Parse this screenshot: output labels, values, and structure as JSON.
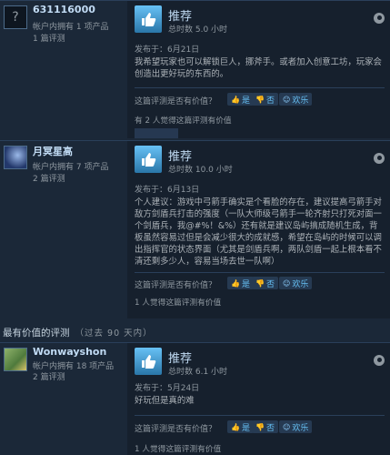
{
  "reviews": [
    {
      "avatar_glyph": "?",
      "name": "631116000",
      "products": "帐户内拥有 1 项产品",
      "review_count": "1 篇评测",
      "verdict": "推荐",
      "hours": "总时数 5.0 小时",
      "posted": "发布于：6月21日",
      "body": "我希望玩家也可以解锁巨人，挪斧手。或者加入创意工坊，玩家会创造出更好玩的东西的。",
      "question": "这篇评测是否有价值？",
      "yes": "是",
      "no": "否",
      "funny": "欢乐",
      "helpful": "有 2 人觉得这篇评测有价值"
    },
    {
      "avatar_glyph": "",
      "name": "月冥星高",
      "products": "帐户内拥有 7 项产品",
      "review_count": "2 篇评测",
      "verdict": "推荐",
      "hours": "总时数 10.0 小时",
      "posted": "发布于：6月13日",
      "body": "个人建议：游戏中弓箭手确实是个看脸的存在，建议提高弓箭手对敌方剑盾兵打击的强度（一队大师级弓箭手一轮齐射只打死对面一个剑盾兵，我@#%！&%）还有就是建议岛屿搞成随机生成，背板虽然容易过但是会减少很大的成就感，希望在岛屿的时候可以调出指挥官的状态界面（尤其是剑盾兵啊，两队剑盾一起上根本看不清还剩多少人，容易当场去世一队啊）",
      "question": "这篇评测是否有价值？",
      "yes": "是",
      "no": "否",
      "funny": "欢乐",
      "helpful": "1 人觉得这篇评测有价值"
    },
    {
      "avatar_glyph": "",
      "name": "Wonwayshon",
      "products": "帐户内拥有 18 项产品",
      "review_count": "2 篇评测",
      "verdict": "推荐",
      "hours": "总时数 6.1 小时",
      "posted": "发布于：5月24日",
      "body": "好玩但是真的难",
      "question": "这篇评测是否有价值？",
      "yes": "是",
      "no": "否",
      "funny": "欢乐",
      "helpful": "1 人觉得这篇评测有价值"
    }
  ],
  "section": {
    "title": "最有价值的评测",
    "subtitle": "（过去 90 天内）"
  },
  "colors": {
    "background": "#1b2838",
    "panel": "#16202d",
    "accent": "#66c0f4"
  }
}
